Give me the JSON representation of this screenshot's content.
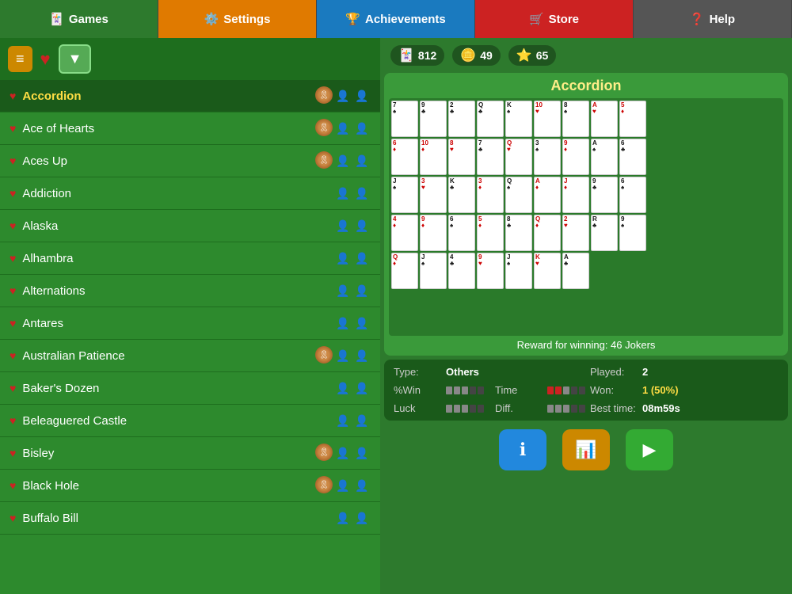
{
  "nav": {
    "items": [
      {
        "id": "games",
        "label": "Games",
        "icon": "🃏",
        "class": "games"
      },
      {
        "id": "settings",
        "label": "Settings",
        "icon": "⚙️",
        "class": "settings"
      },
      {
        "id": "achievements",
        "label": "Achievements",
        "icon": "🏆",
        "class": "achievements"
      },
      {
        "id": "store",
        "label": "Store",
        "icon": "🛒",
        "class": "store"
      },
      {
        "id": "help",
        "label": "Help",
        "icon": "❓",
        "class": "help"
      }
    ]
  },
  "stats": {
    "jokers": "812",
    "coins": "49",
    "stars": "65"
  },
  "game_list": [
    {
      "name": "Accordion",
      "selected": true,
      "has_medal": true
    },
    {
      "name": "Ace of Hearts",
      "selected": false,
      "has_medal": true
    },
    {
      "name": "Aces Up",
      "selected": false,
      "has_medal": true
    },
    {
      "name": "Addiction",
      "selected": false,
      "has_medal": false
    },
    {
      "name": "Alaska",
      "selected": false,
      "has_medal": false
    },
    {
      "name": "Alhambra",
      "selected": false,
      "has_medal": false
    },
    {
      "name": "Alternations",
      "selected": false,
      "has_medal": false
    },
    {
      "name": "Antares",
      "selected": false,
      "has_medal": false
    },
    {
      "name": "Australian Patience",
      "selected": false,
      "has_medal": true
    },
    {
      "name": "Baker's Dozen",
      "selected": false,
      "has_medal": false
    },
    {
      "name": "Beleaguered Castle",
      "selected": false,
      "has_medal": false
    },
    {
      "name": "Bisley",
      "selected": false,
      "has_medal": true
    },
    {
      "name": "Black Hole",
      "selected": false,
      "has_medal": true
    },
    {
      "name": "Buffalo Bill",
      "selected": false,
      "has_medal": false
    }
  ],
  "preview": {
    "title": "Accordion",
    "reward": "Reward for winning: 46 Jokers"
  },
  "game_info": {
    "type_label": "Type:",
    "type_value": "Others",
    "played_label": "Played:",
    "played_value": "2",
    "win_label": "%Win",
    "time_label": "Time",
    "won_label": "Won:",
    "won_value": "1 (50%)",
    "luck_label": "Luck",
    "diff_label": "Diff.",
    "best_time_label": "Best time:",
    "best_time_value": "08m59s"
  },
  "buttons": {
    "info": "ℹ",
    "stats": "📊",
    "play": "▶"
  }
}
